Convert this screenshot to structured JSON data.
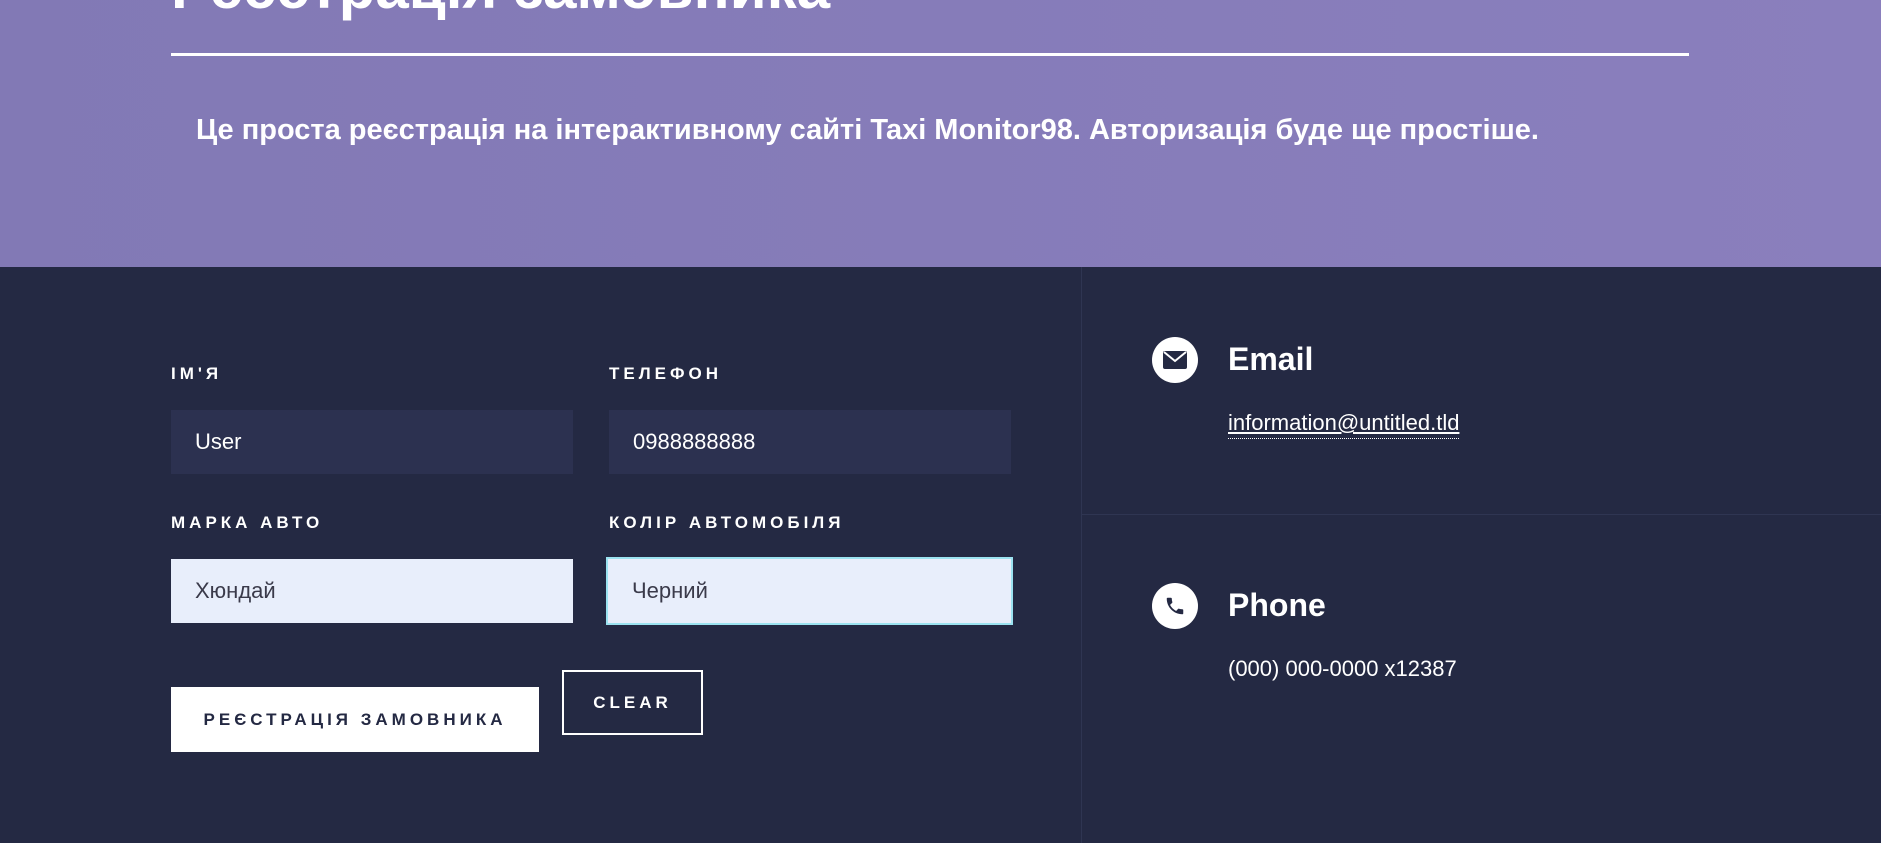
{
  "banner": {
    "title": "Реєстрація замовника",
    "subtitle": "Це проста реєстрація на інтерактивному сайті Taxi Monitor98. Авторизація буде ще простіше."
  },
  "form": {
    "name_label": "ІМ'Я",
    "name_value": "User",
    "phone_label": "ТЕЛЕФОН",
    "phone_value": "0988888888",
    "brand_label": "МАРКА АВТО",
    "brand_value": "Хюндай",
    "color_label": "КОЛІР АВТОМОБІЛЯ",
    "color_value": "Черний",
    "submit_label": "РЕЄСТРАЦІЯ ЗАМОВНИКА",
    "clear_label": "CLEAR"
  },
  "contacts": {
    "email_title": "Email",
    "email_value": "information@untitled.tld",
    "phone_title": "Phone",
    "phone_value": "(000) 000-0000 x12387",
    "email_icon": "envelope-icon",
    "phone_icon": "phone-icon"
  },
  "colors": {
    "banner": "#8a7fbd",
    "background": "#242943",
    "input_dark": "#2c3150",
    "input_light": "#e8eefb",
    "focus_border": "#9be2f0"
  }
}
